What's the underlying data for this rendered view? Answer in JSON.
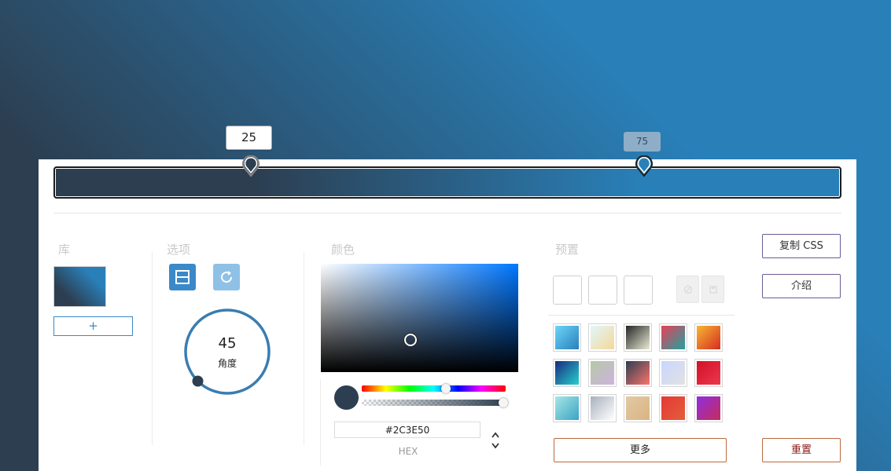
{
  "gradient": {
    "colors": [
      "#2C3E50",
      "#2980B9"
    ],
    "stops": [
      {
        "position": 25,
        "color": "#2C3E50",
        "active": true
      },
      {
        "position": 75,
        "color": "#2980B9",
        "active": false
      }
    ],
    "angle": 45
  },
  "sections": {
    "library": "库",
    "options": "选项",
    "color": "颜色",
    "presets": "预置"
  },
  "library": {
    "add_label": "+"
  },
  "options": {
    "angle_value": "45",
    "angle_label": "角度",
    "linear_icon": "linear-mode-icon",
    "radial_icon": "rotate-icon"
  },
  "color_picker": {
    "hex_value": "#2C3E50",
    "mode_label": "HEX",
    "hue": 215,
    "alpha": 1
  },
  "presets": {
    "more_label": "更多",
    "gradients": [
      [
        "#6dd5fa",
        "#2980b9"
      ],
      [
        "#e0f7fa",
        "#f5d89a"
      ],
      [
        "#232526",
        "#ebebd3"
      ],
      [
        "#e94057",
        "#1fa2a0"
      ],
      [
        "#f7b733",
        "#d62d20"
      ],
      [
        "#1a2980",
        "#26d0ce"
      ],
      [
        "#b5c9a8",
        "#cdb3dd"
      ],
      [
        "#2c3e50",
        "#fd746c"
      ],
      [
        "#c9d6ff",
        "#e2e2e2"
      ],
      [
        "#d31027",
        "#ea384d"
      ],
      [
        "#a8e6e6",
        "#3aa3c4"
      ],
      [
        "#a9b0bd",
        "#ffffff"
      ],
      [
        "#e3c9a4",
        "#d9b482"
      ],
      [
        "#e53935",
        "#e35d3b"
      ],
      [
        "#8e2de2",
        "#c62d5a"
      ]
    ]
  },
  "actions": {
    "copy_css": "复制 CSS",
    "intro": "介绍",
    "reset": "重置"
  }
}
